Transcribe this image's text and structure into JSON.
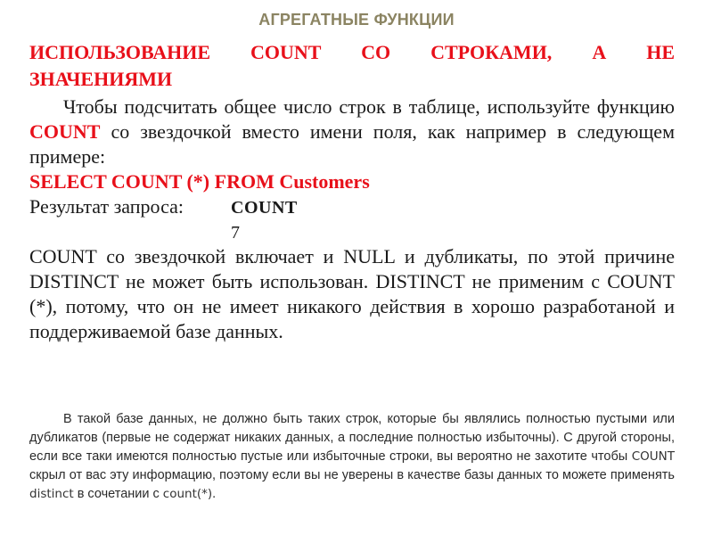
{
  "slide": {
    "title": "АГРЕГАТНЫЕ ФУНКЦИИ"
  },
  "section": {
    "heading": "ИСПОЛЬЗОВАНИЕ COUNT СО СТРОКАМИ, А НЕ ЗНАЧЕНИЯМИ",
    "intro_part1": "Чтобы подсчитать общее число строк в таблице, используйте функцию ",
    "intro_keyword": "COUNT",
    "intro_part2": " со звездочкой вместо имени поля, как например в следующем примере:",
    "sql_query": "SELECT COUNT (*) FROM Customers",
    "result_label": "Результат запроса:",
    "result_table": {
      "header": "COUNT",
      "value": "7"
    },
    "explanation": "COUNT со звездочкой включает и NULL и дубликаты, по этой причине DISTINCT не может быть использован. DISTINCT не применим с COUNT (*), потому, что он не имеет никакого действия в хорошо разработаной и поддерживаемой базе данных."
  },
  "note": {
    "text_part1": "В такой базе данных, не должно быть таких строк, которые бы являлись полностью пустыми или дубликатов (первые не содержат никаких данных, а последние полностью избыточны). С другой стороны, если все таки имеются полностью пустые или избыточные строки, вы вероятно не захотите чтобы ",
    "keyword_count": "COUNT",
    "text_part2": " скрыл от вас эту информацию, поэтому если вы не уверены в качестве базы данных то можете применять ",
    "keyword_distinct": "distinct",
    "text_part3": " в сочетании с ",
    "keyword_count_star": "count(*)",
    "text_part4": "."
  },
  "colors": {
    "title": "#8b8462",
    "accent_red": "#e8101a",
    "body_text": "#1a1a1a"
  }
}
